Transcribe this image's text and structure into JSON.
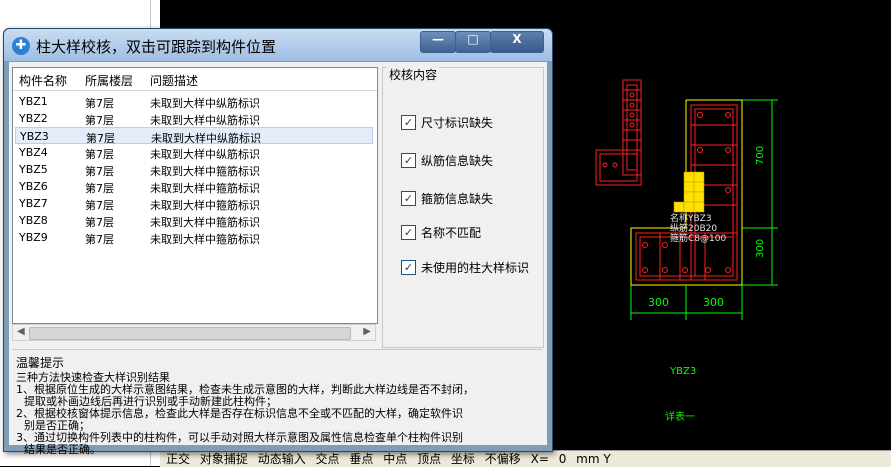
{
  "dialog": {
    "title": "柱大样校核，双击可跟踪到构件位置",
    "min_label": "—",
    "max_label": "□",
    "close_label": "X"
  },
  "list": {
    "headers": [
      "构件名称",
      "所属楼层",
      "问题描述"
    ],
    "rows": [
      [
        "YBZ1",
        "第7层",
        "未取到大样中纵筋标识"
      ],
      [
        "YBZ2",
        "第7层",
        "未取到大样中纵筋标识"
      ],
      [
        "YBZ3",
        "第7层",
        "未取到大样中纵筋标识"
      ],
      [
        "YBZ4",
        "第7层",
        "未取到大样中纵筋标识"
      ],
      [
        "YBZ5",
        "第7层",
        "未取到大样中箍筋标识"
      ],
      [
        "YBZ6",
        "第7层",
        "未取到大样中箍筋标识"
      ],
      [
        "YBZ7",
        "第7层",
        "未取到大样中箍筋标识"
      ],
      [
        "YBZ8",
        "第7层",
        "未取到大样中箍筋标识"
      ],
      [
        "YBZ9",
        "第7层",
        "未取到大样中箍筋标识"
      ]
    ],
    "selected_index": 2
  },
  "check": {
    "title": "校核内容",
    "items": [
      {
        "label": "尺寸标识缺失",
        "checked": true
      },
      {
        "label": "纵筋信息缺失",
        "checked": true
      },
      {
        "label": "箍筋信息缺失",
        "checked": true
      },
      {
        "label": "名称不匹配",
        "checked": true
      },
      {
        "label": "未使用的柱大样标识",
        "checked": true
      }
    ]
  },
  "tips": {
    "title": "温馨提示",
    "lines": [
      "三种方法快速检查大样识别结果",
      "1、根据原位生成的大样示意图结果，检查未生成示意图的大样，判断此大样边线是否不封闭，",
      "提取或补画边线后再进行识别或手动新建此柱构件；",
      "2、根据校核窗体提示信息，检查此大样是否存在标识信息不全或不匹配的大样，确定软件识",
      "别是否正确；",
      "3、通过切换构件列表中的柱构件，可以手动对照大样示意图及属性信息检查单个柱构件识别",
      "结果是否正确。"
    ]
  },
  "cad": {
    "dim_700": "700",
    "dim_300_v": "300",
    "dim_300_a": "300",
    "dim_300_b": "300",
    "label_name": "名称YBZ3",
    "label_zj": "纵筋20B20",
    "label_gj": "箍筋C8@100",
    "label_ybz3": "YBZ3",
    "label_detail": "详表一"
  },
  "statusbar": {
    "items": [
      "正交",
      "对象捕捉",
      "动态输入",
      "交点",
      "垂点",
      "中点",
      "顶点",
      "坐标",
      "不偏移",
      "X=",
      "0",
      "mm Y"
    ]
  },
  "colors": {
    "cad_bg": "#000000",
    "rebar_red": "#ff2020",
    "outline_yellow": "#ffff00",
    "dim_green": "#00ff00",
    "label_white": "#e0e0e0",
    "hatch_yellow": "#ffe000"
  }
}
